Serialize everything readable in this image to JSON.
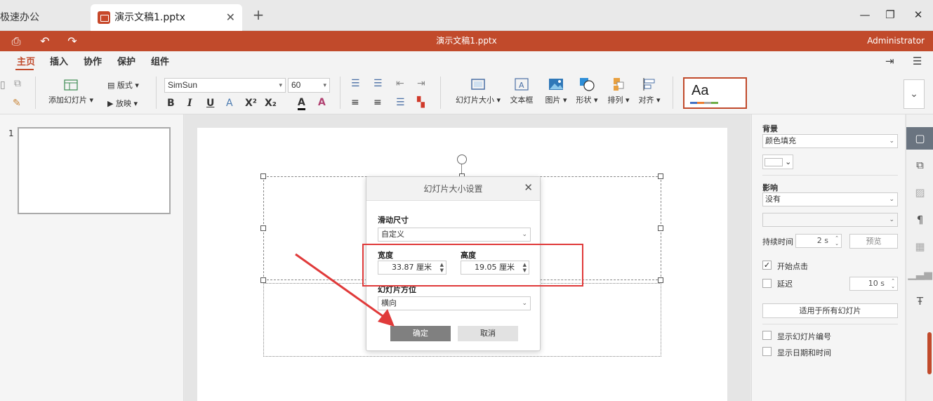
{
  "tabs": {
    "left_partial": "极速办公",
    "active": "演示文稿1.pptx",
    "close": "✕",
    "add": "+"
  },
  "window": {
    "minimize": "—",
    "restore": "❐",
    "close": "✕"
  },
  "titlebar": {
    "title": "演示文稿1.pptx",
    "user": "Administrator"
  },
  "menu": {
    "items": [
      "主页",
      "插入",
      "协作",
      "保护",
      "组件"
    ]
  },
  "ribbon": {
    "add_slide": "添加幻灯片",
    "layout": "版式",
    "play": "放映",
    "font_family": "SimSun",
    "font_size": "60",
    "slide_size": "幻灯片大小",
    "textbox": "文本框",
    "image": "图片",
    "shape": "形状",
    "arrange": "排列",
    "align": "对齐",
    "theme_sample": "Aa"
  },
  "thumbnails": {
    "slide_number": "1"
  },
  "dialog": {
    "title": "幻灯片大小设置",
    "size_label": "滑动尺寸",
    "size_value": "自定义",
    "width_label": "宽度",
    "width_value": "33.87 厘米",
    "height_label": "高度",
    "height_value": "19.05 厘米",
    "orientation_label": "幻灯片方位",
    "orientation_value": "横向",
    "ok": "确定",
    "cancel": "取消"
  },
  "right_panel": {
    "background_label": "背景",
    "background_fill": "颜色填充",
    "effect_label": "影响",
    "effect_value": "没有",
    "duration_label": "持续时间",
    "duration_value": "2 s",
    "preview": "预览",
    "start_on_click": "开始点击",
    "delay": "延迟",
    "delay_value": "10 s",
    "apply_all": "适用于所有幻灯片",
    "show_slide_number": "显示幻灯片编号",
    "show_date_time": "显示日期和时间"
  },
  "colors": {
    "accent": "#c14a2b",
    "highlight": "#e03a3a"
  }
}
